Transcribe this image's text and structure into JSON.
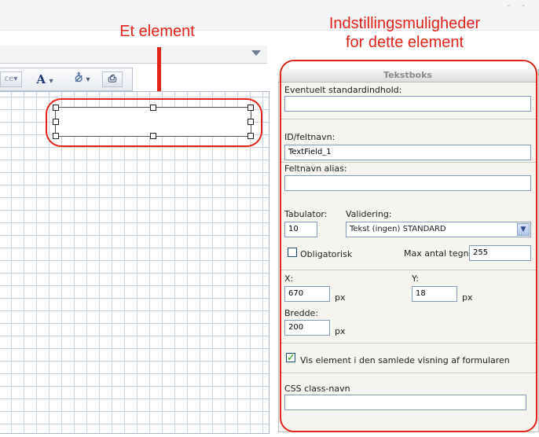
{
  "annotations": {
    "left": "Et element",
    "right_line1": "Indstillingsmuligheder",
    "right_line2": "for dette element"
  },
  "toolbar": {
    "partial_label": "ce",
    "font_glyph": "A",
    "fill_glyph": "⦲",
    "dropdown_glyph": "▾",
    "print_glyph": "⎙"
  },
  "panel": {
    "title": "Tekstboks",
    "default_label": "Eventuelt standardindhold:",
    "default_value": "",
    "id_label": "ID/feltnavn:",
    "id_value": "TextField_1",
    "alias_label": "Feltnavn alias:",
    "alias_value": "",
    "tab_label": "Tabulator:",
    "tab_value": "10",
    "validation_label": "Validering:",
    "validation_value": "Tekst (ingen) STANDARD",
    "required_label": "Obligatorisk",
    "required_checked": false,
    "maxlen_label": "Max antal tegn:",
    "maxlen_value": "255",
    "x_label": "X:",
    "x_value": "670",
    "x_unit": "px",
    "y_label": "Y:",
    "y_value": "18",
    "y_unit": "px",
    "width_label": "Bredde:",
    "width_value": "200",
    "width_unit": "px",
    "show_label": "Vis element i den samlede visning af formularen",
    "show_checked": true,
    "css_label": "CSS class-navn",
    "css_value": ""
  },
  "colors": {
    "annotation": "#e2231a",
    "panel_bg": "#f5f4ee",
    "grid_line": "#c9d3e0"
  }
}
